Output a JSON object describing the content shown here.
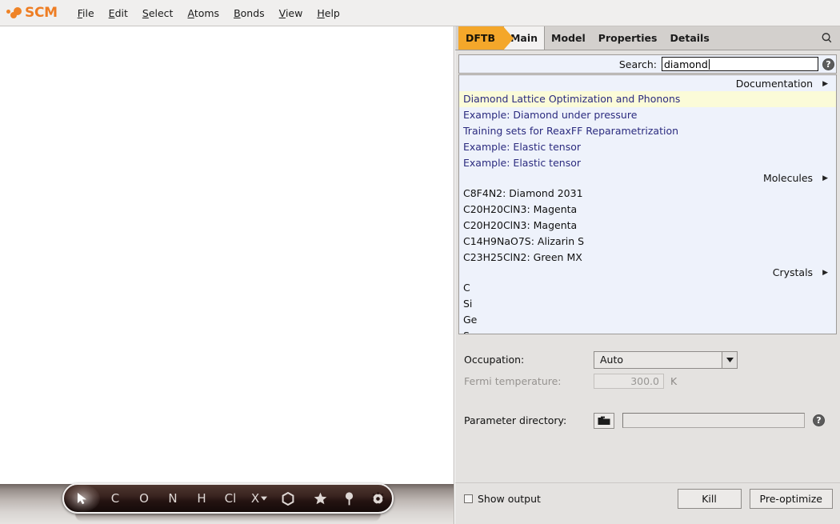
{
  "app": {
    "brand": "SCM",
    "menus": [
      {
        "label": "File",
        "accel": "F"
      },
      {
        "label": "Edit",
        "accel": "E"
      },
      {
        "label": "Select",
        "accel": "S"
      },
      {
        "label": "Atoms",
        "accel": "A"
      },
      {
        "label": "Bonds",
        "accel": "B"
      },
      {
        "label": "View",
        "accel": "V"
      },
      {
        "label": "Help",
        "accel": "H"
      }
    ]
  },
  "panel": {
    "badge": "DFTB",
    "tabs": [
      {
        "label": "Main",
        "active": true
      },
      {
        "label": "Model",
        "active": false
      },
      {
        "label": "Properties",
        "active": false
      },
      {
        "label": "Details",
        "active": false
      }
    ],
    "search_icon": "magnifier-icon"
  },
  "search": {
    "label": "Search:",
    "value": "diamond",
    "placeholder": "",
    "help": "?"
  },
  "results": {
    "sections": [
      {
        "title": "Documentation",
        "arrow": "▶",
        "items": [
          {
            "text": "Diamond Lattice Optimization and Phonons",
            "style": "link",
            "highlighted": true
          },
          {
            "text": "Example: Diamond under pressure",
            "style": "link",
            "highlighted": false
          },
          {
            "text": "Training sets for ReaxFF Reparametrization",
            "style": "link",
            "highlighted": false
          },
          {
            "text": "Example: Elastic tensor",
            "style": "link",
            "highlighted": false
          },
          {
            "text": "Example: Elastic tensor",
            "style": "link",
            "highlighted": false
          }
        ]
      },
      {
        "title": "Molecules",
        "arrow": "▶",
        "items": [
          {
            "text": "C8F4N2: Diamond 2031",
            "style": "plain",
            "highlighted": false
          },
          {
            "text": "C20H20ClN3: Magenta",
            "style": "plain",
            "highlighted": false
          },
          {
            "text": "C20H20ClN3: Magenta",
            "style": "plain",
            "highlighted": false
          },
          {
            "text": "C14H9NaO7S: Alizarin S",
            "style": "plain",
            "highlighted": false
          },
          {
            "text": "C23H25ClN2: Green MX",
            "style": "plain",
            "highlighted": false
          }
        ]
      },
      {
        "title": "Crystals",
        "arrow": "▶",
        "items": [
          {
            "text": "C",
            "style": "plain",
            "highlighted": false
          },
          {
            "text": "Si",
            "style": "plain",
            "highlighted": false
          },
          {
            "text": "Ge",
            "style": "plain",
            "highlighted": false
          },
          {
            "text": "Sn",
            "style": "plain",
            "highlighted": false
          }
        ]
      }
    ]
  },
  "form": {
    "occupation_label": "Occupation:",
    "occupation_value": "Auto",
    "fermi_label": "Fermi temperature:",
    "fermi_value": "300.0",
    "fermi_unit": "K",
    "param_label": "Parameter directory:",
    "param_value": "",
    "param_help": "?",
    "folder_icon": "folder-icon"
  },
  "bottom": {
    "show_output_label": "Show output",
    "kill_label": "Kill",
    "preoptimize_label": "Pre-optimize"
  },
  "toolbar": {
    "items": [
      {
        "label": "",
        "icon": "cursor-arrow-icon",
        "selected": true
      },
      {
        "label": "C",
        "icon": "",
        "selected": false
      },
      {
        "label": "O",
        "icon": "",
        "selected": false
      },
      {
        "label": "N",
        "icon": "",
        "selected": false
      },
      {
        "label": "H",
        "icon": "",
        "selected": false
      },
      {
        "label": "Cl",
        "icon": "",
        "selected": false
      },
      {
        "label": "X",
        "icon": "chevron-down-icon",
        "selected": false
      },
      {
        "label": "",
        "icon": "benzene-ring-icon",
        "selected": false
      },
      {
        "label": "",
        "icon": "star-icon",
        "selected": false
      },
      {
        "label": "",
        "icon": "pin-icon",
        "selected": false
      },
      {
        "label": "",
        "icon": "gear-icon",
        "selected": false
      }
    ]
  },
  "colors": {
    "brand_orange": "#ee7d23",
    "badge_orange": "#f4a72a",
    "link_blue": "#2b2b7f",
    "highlight_yellow": "#fbfbd8",
    "panel_bg": "#e4e2e0",
    "list_bg": "#eef2fb"
  }
}
